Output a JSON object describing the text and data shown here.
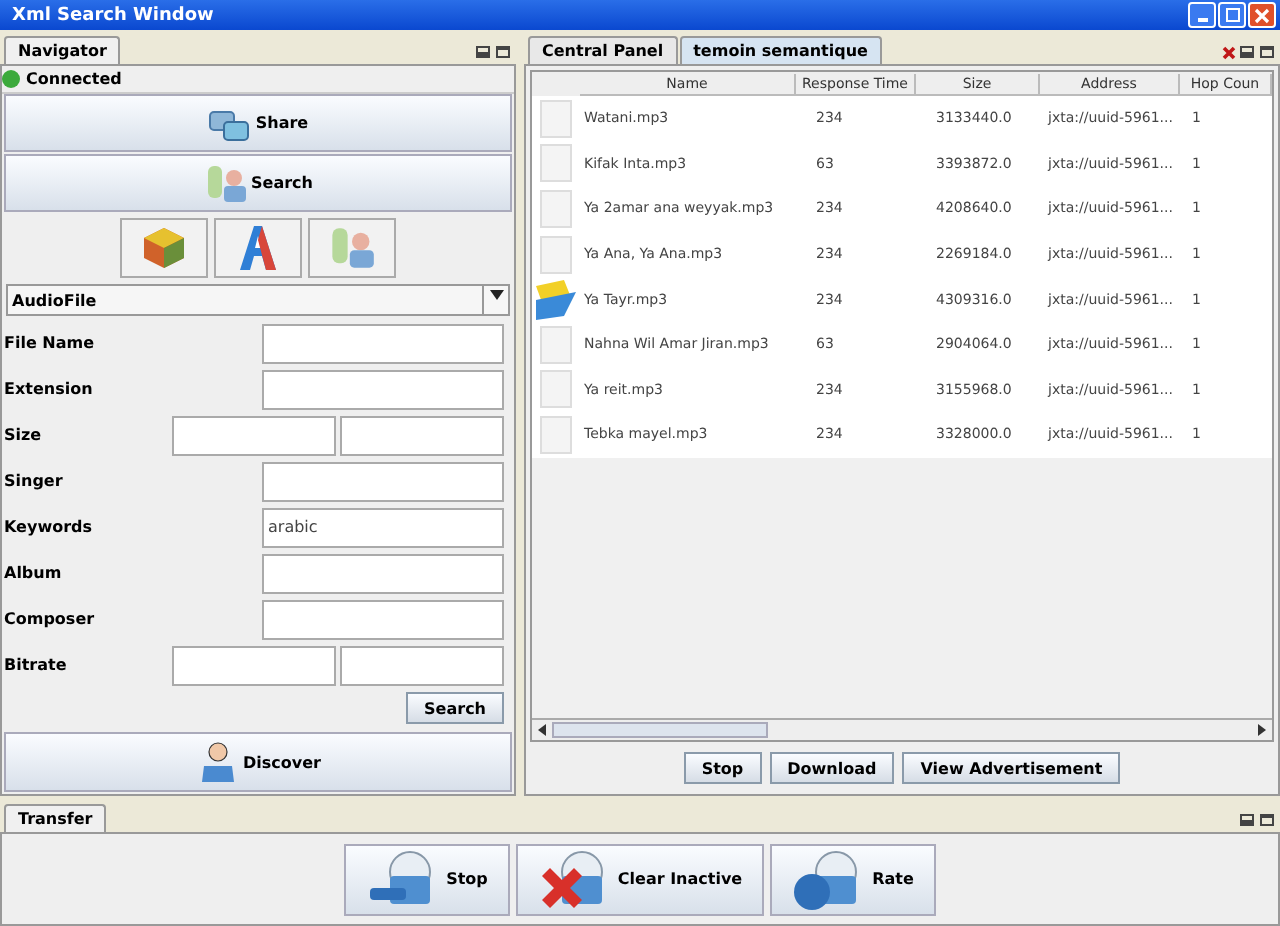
{
  "window": {
    "title": "Xml Search Window"
  },
  "navigator": {
    "tab": "Navigator",
    "status": "Connected",
    "connected": true,
    "nav_buttons": [
      {
        "label": "Share",
        "kind": "share"
      },
      {
        "label": "Search",
        "kind": "search"
      }
    ],
    "tool_buttons": [
      {
        "kind": "cube"
      },
      {
        "kind": "letter"
      },
      {
        "kind": "search"
      }
    ],
    "file_type": "AudioFile",
    "fields": [
      {
        "label": "File Name",
        "kind": "single"
      },
      {
        "label": "Extension",
        "kind": "single"
      },
      {
        "label": "Size",
        "kind": "range"
      },
      {
        "label": "Singer",
        "kind": "single"
      },
      {
        "label": "Keywords",
        "kind": "single",
        "value": "arabic"
      },
      {
        "label": "Album",
        "kind": "single"
      },
      {
        "label": "Composer",
        "kind": "single"
      },
      {
        "label": "Bitrate",
        "kind": "range"
      }
    ],
    "search_button": "Search",
    "discover_button": "Discover"
  },
  "central": {
    "tabs": [
      {
        "label": "Central Panel",
        "selected": false
      },
      {
        "label": "temoin semantique",
        "selected": true
      }
    ],
    "columns": [
      "Name",
      "Response Time",
      "Size",
      "Address",
      "Hop Coun"
    ],
    "rows": [
      {
        "kind": "file",
        "cells": [
          "Watani.mp3",
          "234",
          "3133440.0",
          "jxta://uuid-5961...",
          "1"
        ]
      },
      {
        "kind": "file",
        "cells": [
          "Kifak Inta.mp3",
          "63",
          "3393872.0",
          "jxta://uuid-5961...",
          "1"
        ]
      },
      {
        "kind": "file",
        "cells": [
          "Ya 2amar ana weyyak.mp3",
          "234",
          "4208640.0",
          "jxta://uuid-5961...",
          "1"
        ]
      },
      {
        "kind": "file",
        "cells": [
          "Ya Ana, Ya Ana.mp3",
          "234",
          "2269184.0",
          "jxta://uuid-5961...",
          "1"
        ]
      },
      {
        "kind": "folder",
        "cells": [
          "Ya Tayr.mp3",
          "234",
          "4309316.0",
          "jxta://uuid-5961...",
          "1"
        ]
      },
      {
        "kind": "file",
        "cells": [
          "Nahna Wil Amar Jiran.mp3",
          "63",
          "2904064.0",
          "jxta://uuid-5961...",
          "1"
        ]
      },
      {
        "kind": "file",
        "cells": [
          "Ya reit.mp3",
          "234",
          "3155968.0",
          "jxta://uuid-5961...",
          "1"
        ]
      },
      {
        "kind": "file",
        "cells": [
          "Tebka mayel.mp3",
          "234",
          "3328000.0",
          "jxta://uuid-5961...",
          "1"
        ]
      }
    ],
    "buttons": [
      "Stop",
      "Download",
      "View Advertisement"
    ]
  },
  "transfer": {
    "tab": "Transfer",
    "buttons": [
      {
        "label": "Stop",
        "kind": "stop"
      },
      {
        "label": "Clear Inactive",
        "kind": "clear"
      },
      {
        "label": "Rate",
        "kind": "rate"
      }
    ]
  }
}
